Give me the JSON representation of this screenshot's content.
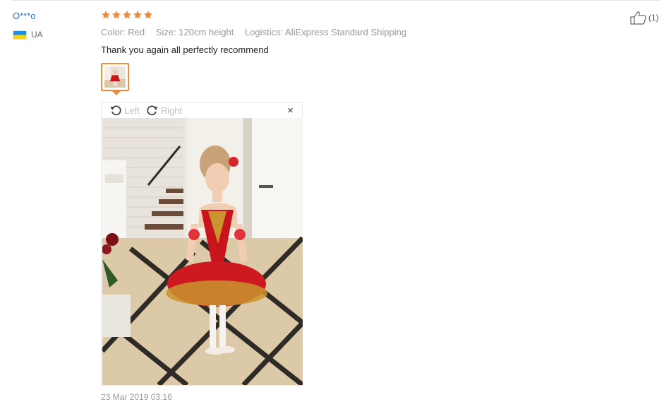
{
  "review": {
    "buyer_name": "O***o",
    "country_code": "UA",
    "rating_stars": 5,
    "sku": {
      "color": "Color: Red",
      "size": "Size: 120cm height",
      "logistics": "Logistics: AliExpress Standard Shipping"
    },
    "feedback": "Thank you again all perfectly recommend",
    "helpful_count": "(1)",
    "date": "23 Mar 2019 03:16"
  },
  "viewer": {
    "rotate_left_label": "Left",
    "rotate_right_label": "Right",
    "close_glyph": "×"
  },
  "icons": {
    "star": "star-icon",
    "thumbs_up": "thumbs-up-icon",
    "rotate_left": "rotate-left-icon",
    "rotate_right": "rotate-right-icon",
    "close": "close-icon"
  },
  "colors": {
    "star": "#f08b3c",
    "name_link": "#2a6fbf",
    "thumb_border": "#f08b3c",
    "muted_text": "#999999"
  }
}
